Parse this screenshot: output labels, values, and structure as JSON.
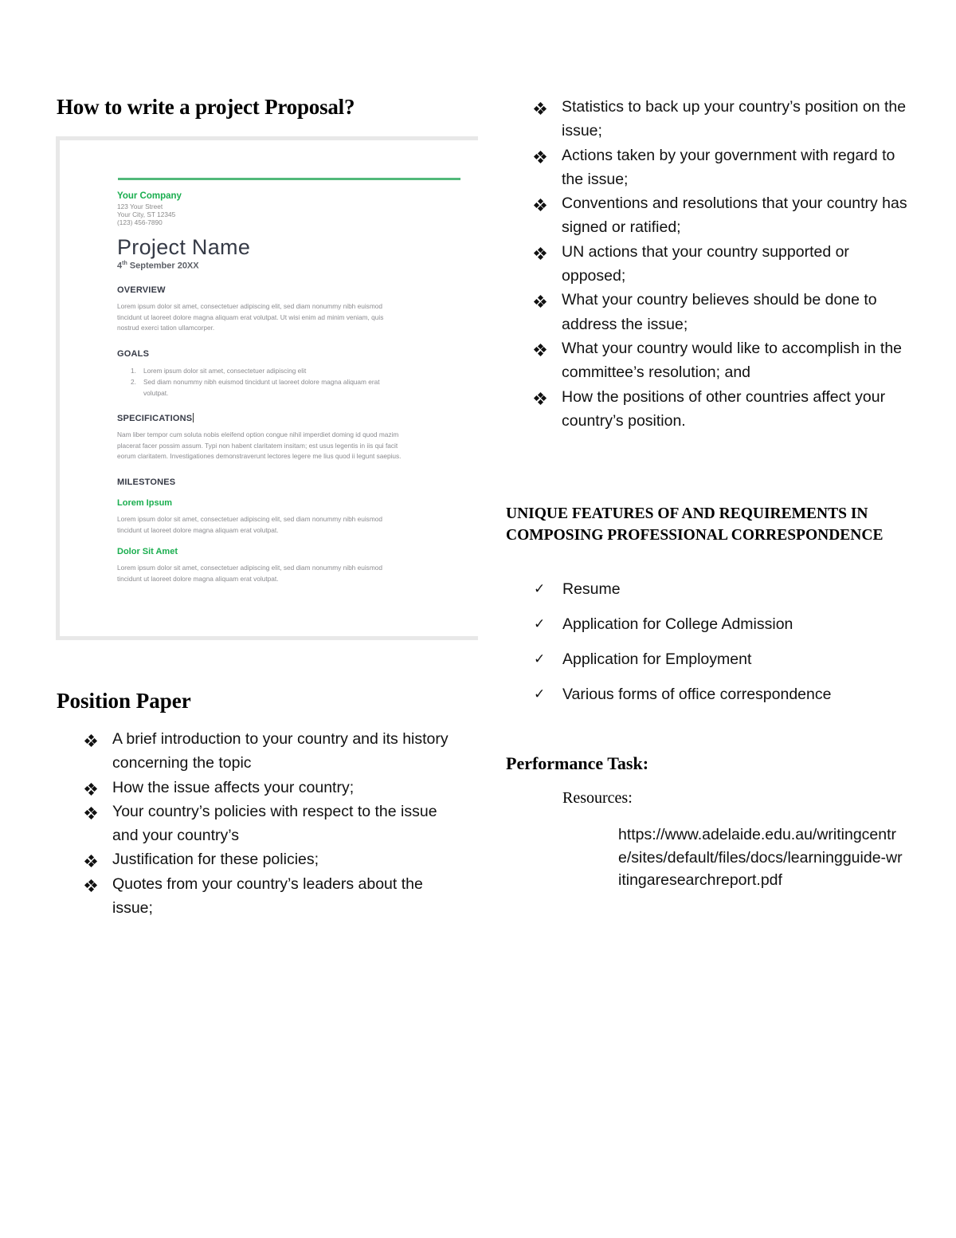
{
  "left_column": {
    "proposal_heading": "How to write a project Proposal?",
    "proposal_template": {
      "company": "Your Company",
      "address_line1": "123 Your Street",
      "address_line2": "Your City, ST 12345",
      "phone": "(123) 456-7890",
      "project_title": "Project Name",
      "date_day": "4",
      "date_suffix": "th",
      "date_rest": " September 20XX",
      "overview_heading": "OVERVIEW",
      "overview_lines": [
        "Lorem ipsum dolor sit amet, consectetuer adipiscing elit, sed diam nonummy nibh euismod",
        "tincidunt ut laoreet dolore magna aliquam erat volutpat. Ut wisi enim ad minim veniam, quis",
        "nostrud exerci tation ullamcorper."
      ],
      "goals_heading": "GOALS",
      "goals": [
        {
          "num": "1.",
          "lines": [
            "Lorem ipsum dolor sit amet, consectetuer adipiscing elit"
          ]
        },
        {
          "num": "2.",
          "lines": [
            "Sed diam nonummy nibh euismod tincidunt ut laoreet dolore magna aliquam erat",
            "volutpat."
          ]
        }
      ],
      "specifications_heading": "SPECIFICATIONS",
      "specifications_lines": [
        "Nam liber tempor cum soluta nobis eleifend option congue nihil imperdiet doming id quod mazim",
        "placerat facer possim assum. Typi non habent claritatem insitam; est usus legentis in iis qui facit",
        "eorum claritatem. Investigationes demonstraverunt lectores legere me lius quod ii legunt saepius."
      ],
      "milestones_heading": "MILESTONES",
      "milestones": [
        {
          "title": "Lorem Ipsum",
          "lines": [
            "Lorem ipsum dolor sit amet, consectetuer adipiscing elit, sed diam nonummy nibh euismod",
            "tincidunt ut laoreet dolore magna aliquam erat volutpat."
          ]
        },
        {
          "title": "Dolor Sit Amet",
          "lines": [
            "Lorem ipsum dolor sit amet, consectetuer adipiscing elit, sed diam nonummy nibh euismod",
            "tincidunt ut laoreet dolore magna aliquam erat volutpat."
          ]
        }
      ],
      "accent_color": "#1aae4f",
      "rule_color": "#52b97a"
    },
    "position_heading": "Position Paper",
    "position_items": [
      "A brief introduction to your country and its history concerning the topic",
      "How the issue affects your country;",
      "Your country’s policies with respect to the issue and your country’s",
      "Justification for these policies;",
      "Quotes from your country’s leaders about the issue;"
    ]
  },
  "right_column": {
    "position_items_continued": [
      "Statistics to back up your country’s position on the issue;",
      "Actions taken by your government with regard to the issue;",
      "Conventions and resolutions that your country has signed or ratified;",
      "UN actions that your country supported or opposed;",
      "What your country believes should be done to address the issue;",
      "What your country would like to accomplish in the committee’s resolution; and",
      "How the positions of other countries affect your country’s position."
    ],
    "features_heading": "UNIQUE FEATURES OF AND REQUIREMENTS IN COMPOSING PROFESSIONAL CORRESPONDENCE",
    "features_items": [
      "Resume",
      "Application for College Admission",
      "Application for Employment",
      "Various forms of office correspondence"
    ],
    "task_heading": "Performance Task:",
    "resources_label": "Resources:",
    "resource_url": "https://www.adelaide.edu.au/writingcentre/sites/default/files/docs/learningguide-writingaresearchreport.pdf"
  },
  "icons": {
    "bullet": "diamond-cluster-icon",
    "check": "check-icon"
  }
}
